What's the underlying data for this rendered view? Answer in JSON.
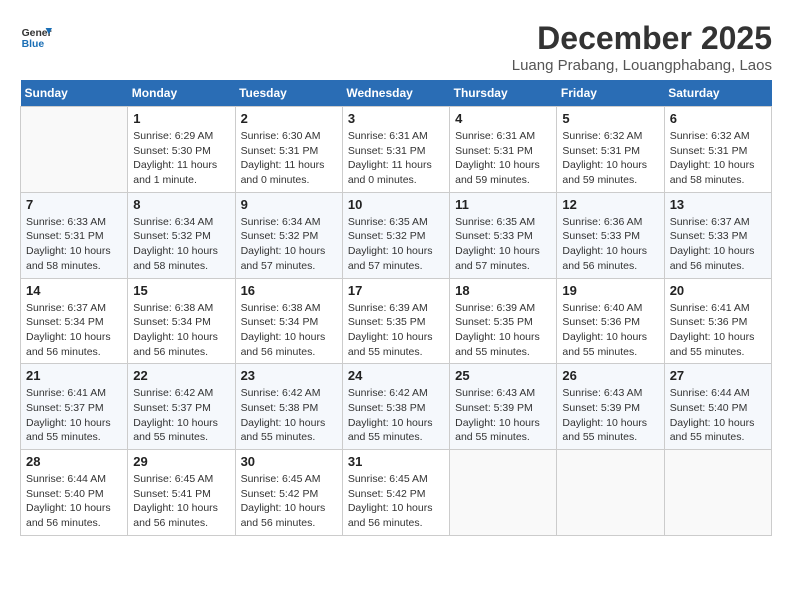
{
  "header": {
    "logo_line1": "General",
    "logo_line2": "Blue",
    "month": "December 2025",
    "location": "Luang Prabang, Louangphabang, Laos"
  },
  "weekdays": [
    "Sunday",
    "Monday",
    "Tuesday",
    "Wednesday",
    "Thursday",
    "Friday",
    "Saturday"
  ],
  "weeks": [
    [
      {
        "day": "",
        "detail": ""
      },
      {
        "day": "1",
        "detail": "Sunrise: 6:29 AM\nSunset: 5:30 PM\nDaylight: 11 hours\nand 1 minute."
      },
      {
        "day": "2",
        "detail": "Sunrise: 6:30 AM\nSunset: 5:31 PM\nDaylight: 11 hours\nand 0 minutes."
      },
      {
        "day": "3",
        "detail": "Sunrise: 6:31 AM\nSunset: 5:31 PM\nDaylight: 11 hours\nand 0 minutes."
      },
      {
        "day": "4",
        "detail": "Sunrise: 6:31 AM\nSunset: 5:31 PM\nDaylight: 10 hours\nand 59 minutes."
      },
      {
        "day": "5",
        "detail": "Sunrise: 6:32 AM\nSunset: 5:31 PM\nDaylight: 10 hours\nand 59 minutes."
      },
      {
        "day": "6",
        "detail": "Sunrise: 6:32 AM\nSunset: 5:31 PM\nDaylight: 10 hours\nand 58 minutes."
      }
    ],
    [
      {
        "day": "7",
        "detail": "Sunrise: 6:33 AM\nSunset: 5:31 PM\nDaylight: 10 hours\nand 58 minutes."
      },
      {
        "day": "8",
        "detail": "Sunrise: 6:34 AM\nSunset: 5:32 PM\nDaylight: 10 hours\nand 58 minutes."
      },
      {
        "day": "9",
        "detail": "Sunrise: 6:34 AM\nSunset: 5:32 PM\nDaylight: 10 hours\nand 57 minutes."
      },
      {
        "day": "10",
        "detail": "Sunrise: 6:35 AM\nSunset: 5:32 PM\nDaylight: 10 hours\nand 57 minutes."
      },
      {
        "day": "11",
        "detail": "Sunrise: 6:35 AM\nSunset: 5:33 PM\nDaylight: 10 hours\nand 57 minutes."
      },
      {
        "day": "12",
        "detail": "Sunrise: 6:36 AM\nSunset: 5:33 PM\nDaylight: 10 hours\nand 56 minutes."
      },
      {
        "day": "13",
        "detail": "Sunrise: 6:37 AM\nSunset: 5:33 PM\nDaylight: 10 hours\nand 56 minutes."
      }
    ],
    [
      {
        "day": "14",
        "detail": "Sunrise: 6:37 AM\nSunset: 5:34 PM\nDaylight: 10 hours\nand 56 minutes."
      },
      {
        "day": "15",
        "detail": "Sunrise: 6:38 AM\nSunset: 5:34 PM\nDaylight: 10 hours\nand 56 minutes."
      },
      {
        "day": "16",
        "detail": "Sunrise: 6:38 AM\nSunset: 5:34 PM\nDaylight: 10 hours\nand 56 minutes."
      },
      {
        "day": "17",
        "detail": "Sunrise: 6:39 AM\nSunset: 5:35 PM\nDaylight: 10 hours\nand 55 minutes."
      },
      {
        "day": "18",
        "detail": "Sunrise: 6:39 AM\nSunset: 5:35 PM\nDaylight: 10 hours\nand 55 minutes."
      },
      {
        "day": "19",
        "detail": "Sunrise: 6:40 AM\nSunset: 5:36 PM\nDaylight: 10 hours\nand 55 minutes."
      },
      {
        "day": "20",
        "detail": "Sunrise: 6:41 AM\nSunset: 5:36 PM\nDaylight: 10 hours\nand 55 minutes."
      }
    ],
    [
      {
        "day": "21",
        "detail": "Sunrise: 6:41 AM\nSunset: 5:37 PM\nDaylight: 10 hours\nand 55 minutes."
      },
      {
        "day": "22",
        "detail": "Sunrise: 6:42 AM\nSunset: 5:37 PM\nDaylight: 10 hours\nand 55 minutes."
      },
      {
        "day": "23",
        "detail": "Sunrise: 6:42 AM\nSunset: 5:38 PM\nDaylight: 10 hours\nand 55 minutes."
      },
      {
        "day": "24",
        "detail": "Sunrise: 6:42 AM\nSunset: 5:38 PM\nDaylight: 10 hours\nand 55 minutes."
      },
      {
        "day": "25",
        "detail": "Sunrise: 6:43 AM\nSunset: 5:39 PM\nDaylight: 10 hours\nand 55 minutes."
      },
      {
        "day": "26",
        "detail": "Sunrise: 6:43 AM\nSunset: 5:39 PM\nDaylight: 10 hours\nand 55 minutes."
      },
      {
        "day": "27",
        "detail": "Sunrise: 6:44 AM\nSunset: 5:40 PM\nDaylight: 10 hours\nand 55 minutes."
      }
    ],
    [
      {
        "day": "28",
        "detail": "Sunrise: 6:44 AM\nSunset: 5:40 PM\nDaylight: 10 hours\nand 56 minutes."
      },
      {
        "day": "29",
        "detail": "Sunrise: 6:45 AM\nSunset: 5:41 PM\nDaylight: 10 hours\nand 56 minutes."
      },
      {
        "day": "30",
        "detail": "Sunrise: 6:45 AM\nSunset: 5:42 PM\nDaylight: 10 hours\nand 56 minutes."
      },
      {
        "day": "31",
        "detail": "Sunrise: 6:45 AM\nSunset: 5:42 PM\nDaylight: 10 hours\nand 56 minutes."
      },
      {
        "day": "",
        "detail": ""
      },
      {
        "day": "",
        "detail": ""
      },
      {
        "day": "",
        "detail": ""
      }
    ]
  ]
}
